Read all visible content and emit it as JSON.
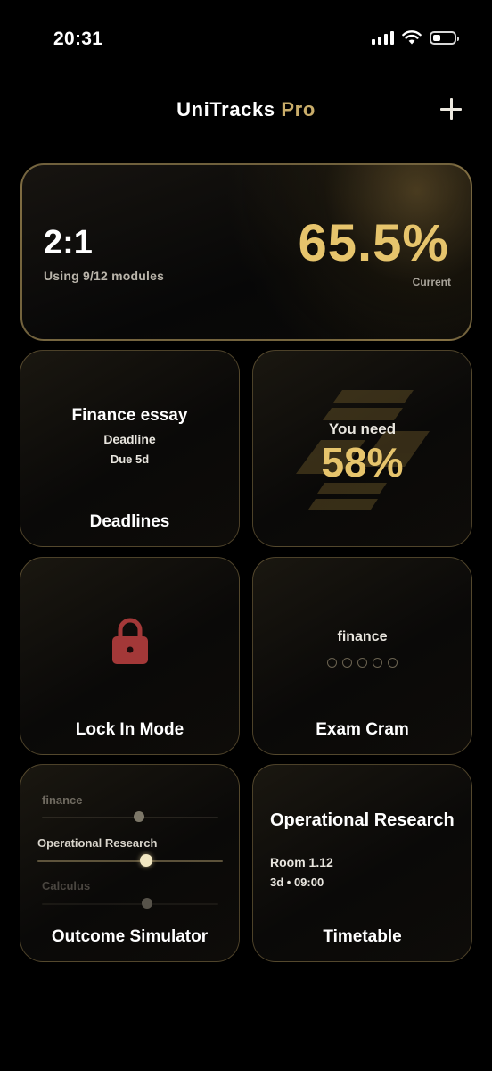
{
  "status_bar": {
    "time": "20:31"
  },
  "header": {
    "title": "UniTracks",
    "title_suffix": "Pro"
  },
  "summary": {
    "classification": "2:1",
    "modules_text": "Using 9/12 modules",
    "average": "65.5%",
    "average_label": "Current"
  },
  "deadlines": {
    "item_title": "Finance essay",
    "item_type": "Deadline",
    "due": "Due 5d",
    "card_title": "Deadlines"
  },
  "target": {
    "label": "You need",
    "value": "58%"
  },
  "lock_in": {
    "card_title": "Lock In Mode"
  },
  "exam_cram": {
    "subject": "finance",
    "progress_dots": 5,
    "card_title": "Exam Cram"
  },
  "simulator": {
    "card_title": "Outcome Simulator",
    "modules": [
      {
        "name": "finance"
      },
      {
        "name": "Operational Research"
      },
      {
        "name": "Calculus"
      }
    ]
  },
  "timetable": {
    "module": "Operational Research",
    "room": "Room 1.12",
    "time": "3d • 09:00",
    "card_title": "Timetable"
  },
  "colors": {
    "accent_gold": "#e6c46c",
    "lock_red": "#a33838",
    "background": "#000000"
  }
}
